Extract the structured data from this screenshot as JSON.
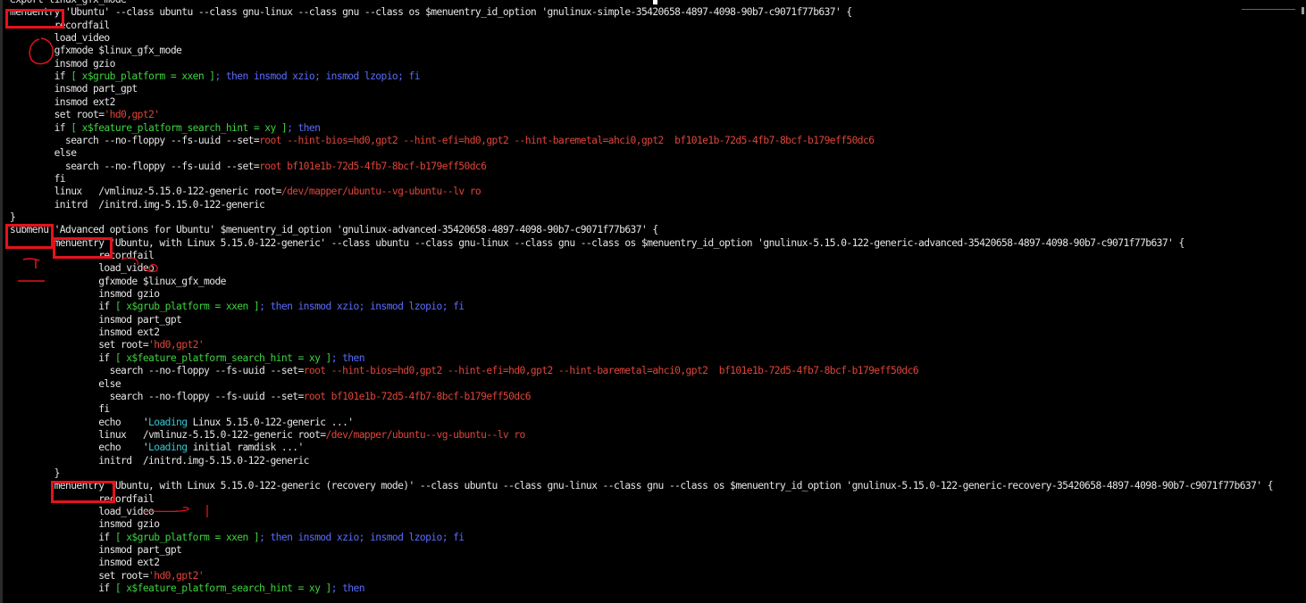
{
  "terminal": {
    "lines": [
      {
        "segs": [
          {
            "t": "export linux_gfx_mode",
            "c": "t-white"
          }
        ]
      },
      {
        "segs": [
          {
            "t": "menuentry 'Ubuntu' --class ubuntu --class gnu-linux --class gnu --class os $menuentry_id_option 'gnulinux-simple-35420658-4897-4098-90b7-c9071f77b637' {",
            "c": "t-white"
          }
        ]
      },
      {
        "segs": [
          {
            "t": "        recordfail",
            "c": "t-white"
          }
        ]
      },
      {
        "segs": [
          {
            "t": "        load_video",
            "c": "t-white"
          }
        ]
      },
      {
        "segs": [
          {
            "t": "        gfxmode $linux_gfx_mode",
            "c": "t-white"
          }
        ]
      },
      {
        "segs": [
          {
            "t": "        insmod gzio",
            "c": "t-white"
          }
        ]
      },
      {
        "segs": [
          {
            "t": "        if ",
            "c": "t-white"
          },
          {
            "t": "[ x$grub_platform = xxen ]",
            "c": "t-green"
          },
          {
            "t": "; then insmod xzio; insmod lzopio; fi",
            "c": "t-blue"
          }
        ]
      },
      {
        "segs": [
          {
            "t": "        insmod part_gpt",
            "c": "t-white"
          }
        ]
      },
      {
        "segs": [
          {
            "t": "        insmod ext2",
            "c": "t-white"
          }
        ]
      },
      {
        "segs": [
          {
            "t": "        set root=",
            "c": "t-white"
          },
          {
            "t": "'hd0,gpt2'",
            "c": "t-red"
          }
        ]
      },
      {
        "segs": [
          {
            "t": "        if ",
            "c": "t-white"
          },
          {
            "t": "[ x$feature_platform_search_hint = xy ]",
            "c": "t-green"
          },
          {
            "t": "; then",
            "c": "t-blue"
          }
        ]
      },
      {
        "segs": [
          {
            "t": "          search --no-floppy --fs-uuid --set=",
            "c": "t-white"
          },
          {
            "t": "root --hint-bios=hd0,gpt2 --hint-efi=hd0,gpt2 --hint-baremetal=ahci0,gpt2  bf101e1b-72d5-4fb7-8bcf-b179eff50dc6",
            "c": "t-red"
          }
        ]
      },
      {
        "segs": [
          {
            "t": "        else",
            "c": "t-white"
          }
        ]
      },
      {
        "segs": [
          {
            "t": "          search --no-floppy --fs-uuid --set=",
            "c": "t-white"
          },
          {
            "t": "root bf101e1b-72d5-4fb7-8bcf-b179eff50dc6",
            "c": "t-red"
          }
        ]
      },
      {
        "segs": [
          {
            "t": "        fi",
            "c": "t-white"
          }
        ]
      },
      {
        "segs": [
          {
            "t": "        linux   /vmlinuz-5.15.0-122-generic root=",
            "c": "t-white"
          },
          {
            "t": "/dev/mapper/ubuntu--vg-ubuntu--lv ro",
            "c": "t-red"
          }
        ]
      },
      {
        "segs": [
          {
            "t": "        initrd  /initrd.img-5.15.0-122-generic",
            "c": "t-white"
          }
        ]
      },
      {
        "segs": [
          {
            "t": "}",
            "c": "t-white"
          }
        ]
      },
      {
        "segs": [
          {
            "t": "submenu 'Advanced options for Ubuntu' $menuentry_id_option 'gnulinux-advanced-35420658-4897-4098-90b7-c9071f77b637' {",
            "c": "t-white"
          }
        ]
      },
      {
        "segs": [
          {
            "t": "        menuentry 'Ubuntu, with Linux 5.15.0-122-generic' --class ubuntu --class gnu-linux --class gnu --class os $menuentry_id_option 'gnulinux-5.15.0-122-generic-advanced-35420658-4897-4098-90b7-c9071f77b637' {",
            "c": "t-white"
          }
        ]
      },
      {
        "segs": [
          {
            "t": "                recordfail",
            "c": "t-white"
          }
        ]
      },
      {
        "segs": [
          {
            "t": "                load_video",
            "c": "t-white"
          }
        ]
      },
      {
        "segs": [
          {
            "t": "                gfxmode $linux_gfx_mode",
            "c": "t-white"
          }
        ]
      },
      {
        "segs": [
          {
            "t": "                insmod gzio",
            "c": "t-white"
          }
        ]
      },
      {
        "segs": [
          {
            "t": "                if ",
            "c": "t-white"
          },
          {
            "t": "[ x$grub_platform = xxen ]",
            "c": "t-green"
          },
          {
            "t": "; then insmod xzio; insmod lzopio; fi",
            "c": "t-blue"
          }
        ]
      },
      {
        "segs": [
          {
            "t": "                insmod part_gpt",
            "c": "t-white"
          }
        ]
      },
      {
        "segs": [
          {
            "t": "                insmod ext2",
            "c": "t-white"
          }
        ]
      },
      {
        "segs": [
          {
            "t": "                set root=",
            "c": "t-white"
          },
          {
            "t": "'hd0,gpt2'",
            "c": "t-red"
          }
        ]
      },
      {
        "segs": [
          {
            "t": "                if ",
            "c": "t-white"
          },
          {
            "t": "[ x$feature_platform_search_hint = xy ]",
            "c": "t-green"
          },
          {
            "t": "; then",
            "c": "t-blue"
          }
        ]
      },
      {
        "segs": [
          {
            "t": "                  search --no-floppy --fs-uuid --set=",
            "c": "t-white"
          },
          {
            "t": "root --hint-bios=hd0,gpt2 --hint-efi=hd0,gpt2 --hint-baremetal=ahci0,gpt2  bf101e1b-72d5-4fb7-8bcf-b179eff50dc6",
            "c": "t-red"
          }
        ]
      },
      {
        "segs": [
          {
            "t": "                else",
            "c": "t-white"
          }
        ]
      },
      {
        "segs": [
          {
            "t": "                  search --no-floppy --fs-uuid --set=",
            "c": "t-white"
          },
          {
            "t": "root bf101e1b-72d5-4fb7-8bcf-b179eff50dc6",
            "c": "t-red"
          }
        ]
      },
      {
        "segs": [
          {
            "t": "                fi",
            "c": "t-white"
          }
        ]
      },
      {
        "segs": [
          {
            "t": "                echo    ",
            "c": "t-white"
          },
          {
            "t": "'",
            "c": "t-white"
          },
          {
            "t": "Loading",
            "c": "t-cyan"
          },
          {
            "t": " Linux 5.15.0-122-generic ...'",
            "c": "t-white"
          }
        ]
      },
      {
        "segs": [
          {
            "t": "                linux   /vmlinuz-5.15.0-122-generic root=",
            "c": "t-white"
          },
          {
            "t": "/dev/mapper/ubuntu--vg-ubuntu--lv ro",
            "c": "t-red"
          }
        ]
      },
      {
        "segs": [
          {
            "t": "                echo    ",
            "c": "t-white"
          },
          {
            "t": "'",
            "c": "t-white"
          },
          {
            "t": "Loading",
            "c": "t-cyan"
          },
          {
            "t": " initial ramdisk ...'",
            "c": "t-white"
          }
        ]
      },
      {
        "segs": [
          {
            "t": "                initrd  /initrd.img-5.15.0-122-generic",
            "c": "t-white"
          }
        ]
      },
      {
        "segs": [
          {
            "t": "        }",
            "c": "t-white"
          }
        ]
      },
      {
        "segs": [
          {
            "t": "        menuentry 'Ubuntu, with Linux 5.15.0-122-generic (recovery mode)' --class ubuntu --class gnu-linux --class gnu --class os $menuentry_id_option 'gnulinux-5.15.0-122-generic-recovery-35420658-4897-4098-90b7-c9071f77b637' {",
            "c": "t-white"
          }
        ]
      },
      {
        "segs": [
          {
            "t": "                recordfail",
            "c": "t-white"
          }
        ]
      },
      {
        "segs": [
          {
            "t": "                load_video",
            "c": "t-white"
          }
        ]
      },
      {
        "segs": [
          {
            "t": "                insmod gzio",
            "c": "t-white"
          }
        ]
      },
      {
        "segs": [
          {
            "t": "                if ",
            "c": "t-white"
          },
          {
            "t": "[ x$grub_platform = xxen ]",
            "c": "t-green"
          },
          {
            "t": "; then insmod xzio; insmod lzopio; fi",
            "c": "t-blue"
          }
        ]
      },
      {
        "segs": [
          {
            "t": "                insmod part_gpt",
            "c": "t-white"
          }
        ]
      },
      {
        "segs": [
          {
            "t": "                insmod ext2",
            "c": "t-white"
          }
        ]
      },
      {
        "segs": [
          {
            "t": "                set root=",
            "c": "t-white"
          },
          {
            "t": "'hd0,gpt2'",
            "c": "t-red"
          }
        ]
      },
      {
        "segs": [
          {
            "t": "                if ",
            "c": "t-white"
          },
          {
            "t": "[ x$feature_platform_search_hint = xy ]",
            "c": "t-green"
          },
          {
            "t": "; then",
            "c": "t-blue"
          }
        ]
      }
    ]
  },
  "annotations": {
    "boxes": [
      "menuentry",
      "submenu",
      "menuentry",
      "menuentry"
    ],
    "color": "#e5121c"
  }
}
